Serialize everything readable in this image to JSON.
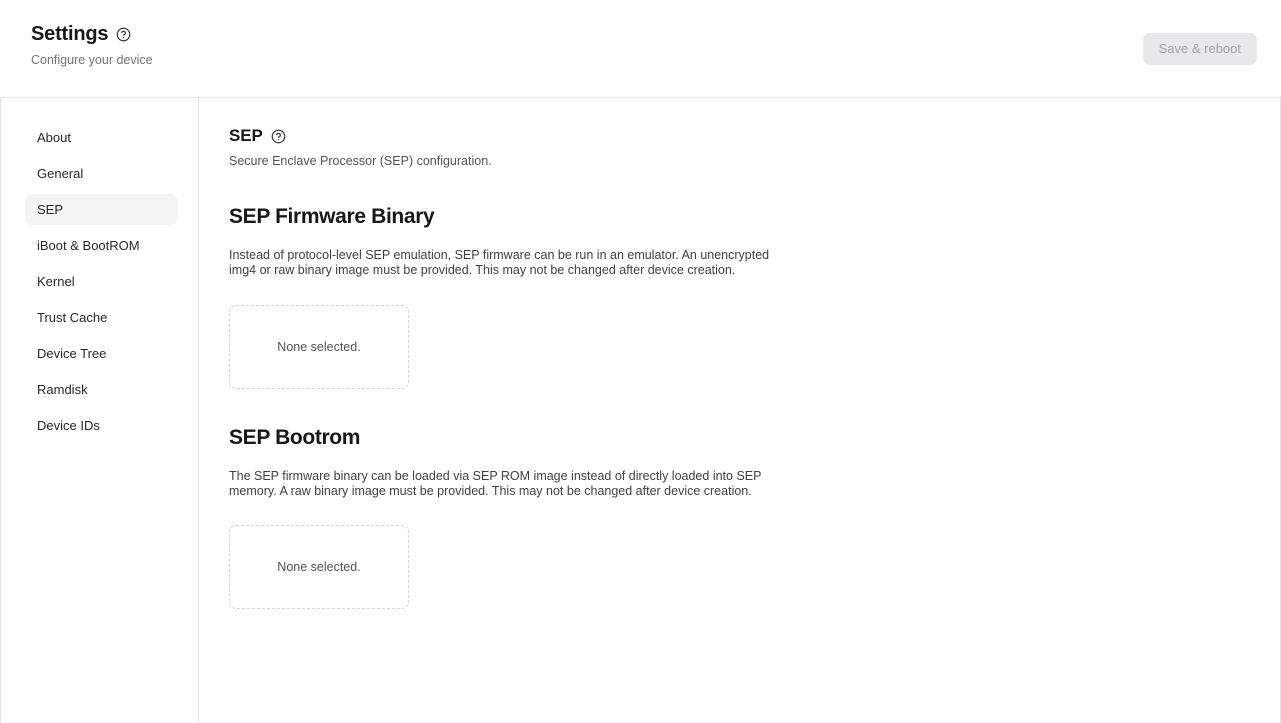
{
  "header": {
    "title": "Settings",
    "help_icon": "help-circle-icon",
    "subtitle": "Configure your device",
    "save_button": "Save & reboot",
    "save_button_disabled": true
  },
  "sidebar": {
    "items": [
      {
        "label": "About",
        "active": false
      },
      {
        "label": "General",
        "active": false
      },
      {
        "label": "SEP",
        "active": true
      },
      {
        "label": "iBoot & BootROM",
        "active": false
      },
      {
        "label": "Kernel",
        "active": false
      },
      {
        "label": "Trust Cache",
        "active": false
      },
      {
        "label": "Device Tree",
        "active": false
      },
      {
        "label": "Ramdisk",
        "active": false
      },
      {
        "label": "Device IDs",
        "active": false
      }
    ]
  },
  "main": {
    "page_title": "SEP",
    "page_help_icon": "help-circle-icon",
    "page_subtitle": "Secure Enclave Processor (SEP) configuration.",
    "sections": [
      {
        "title": "SEP Firmware Binary",
        "description": "Instead of protocol-level SEP emulation, SEP firmware can be run in an emulator. An unencrypted img4 or raw binary image must be provided. This may not be changed after device creation.",
        "dropzone_label": "None selected."
      },
      {
        "title": "SEP Bootrom",
        "description": "The SEP firmware binary can be loaded via SEP ROM image instead of directly loaded into SEP memory. A raw binary image must be provided. This may not be changed after device creation.",
        "dropzone_label": "None selected."
      }
    ]
  },
  "colors": {
    "border": "#e4e4e7",
    "active_nav_bg": "#f4f4f5",
    "text_primary": "#18181b",
    "text_muted": "#71717a",
    "disabled_button_bg": "#e8e8ea",
    "disabled_button_text": "#a1a1aa",
    "dropzone_border": "#d4d4d8"
  }
}
